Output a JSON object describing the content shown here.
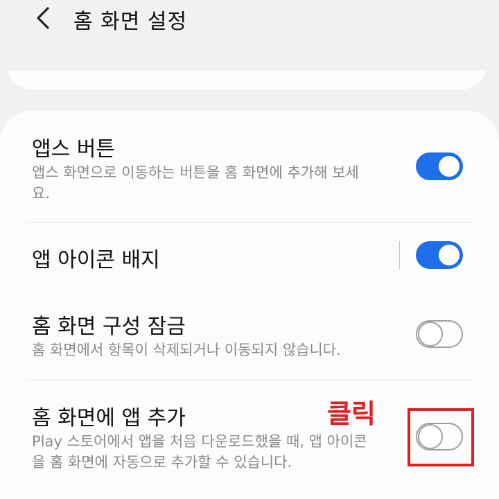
{
  "header": {
    "title": "홈 화면 설정",
    "back_icon": "chevron-left-icon"
  },
  "settings": [
    {
      "title": "앱스 버튼",
      "description": "앱스 화면으로 이동하는 버튼을 홈 화면에 추가해 보세요.",
      "toggle": "on"
    },
    {
      "title": "앱 아이콘 배지",
      "description": "",
      "toggle": "on"
    },
    {
      "title": "홈 화면 구성 잠금",
      "description": "홈 화면에서 항목이 삭제되거나 이동되지 않습니다.",
      "toggle": "off"
    },
    {
      "title": "홈 화면에 앱 추가",
      "description": "Play 스토어에서 앱을 처음 다운로드했을 때, 앱 아이콘을 홈 화면에 자동으로 추가할 수 있습니다.",
      "toggle": "off"
    }
  ],
  "annotation": {
    "label": "클릭",
    "color": "#e02020"
  },
  "colors": {
    "accent": "#1f6fe8",
    "background": "#f1f1f3",
    "card": "#fcfcfc"
  }
}
